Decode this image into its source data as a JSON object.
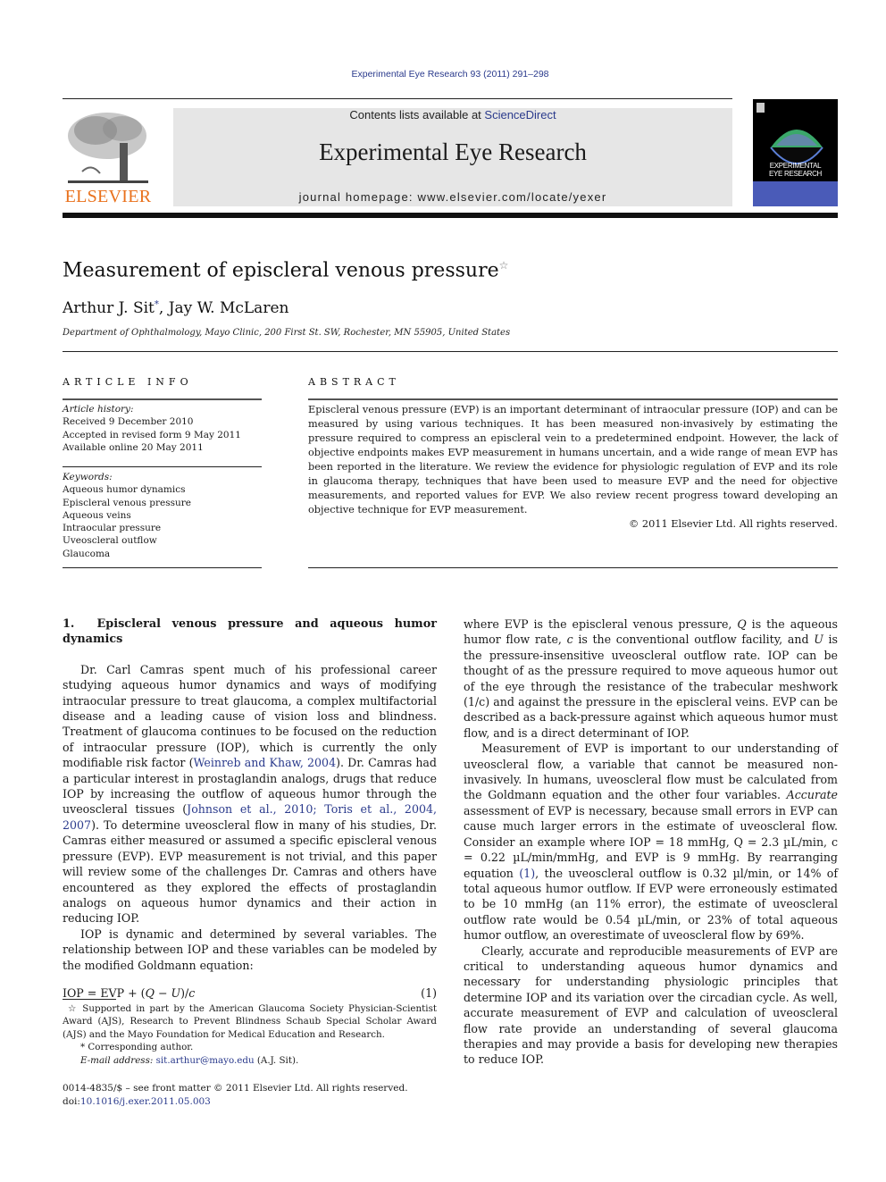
{
  "header": {
    "journal_ref": "Experimental Eye Research 93 (2011) 291–298",
    "contents_prefix": "Contents lists available at ",
    "contents_link": "ScienceDirect",
    "journal_title": "Experimental Eye Research",
    "homepage": "journal homepage: www.elsevier.com/locate/yexer",
    "publisher_logo_text": "ELSEVIER",
    "cover_title_line1": "EXPERIMENTAL",
    "cover_title_line2": "EYE RESEARCH",
    "colors": {
      "publisher_orange": "#e9711c",
      "link_blue": "#2a3a8c",
      "masthead_gray": "#e6e6e6",
      "cover_band": "#4a5bb8"
    }
  },
  "article": {
    "title": "Measurement of episcleral venous pressure",
    "title_note_mark": "☆",
    "author1": "Arthur J. Sit",
    "author1_mark": "*",
    "author2": ", Jay W. McLaren",
    "affiliation": "Department of Ophthalmology, Mayo Clinic, 200 First St. SW, Rochester, MN 55905, United States"
  },
  "article_info": {
    "heading": "ARTICLE INFO",
    "history_label": "Article history:",
    "history": [
      "Received 9 December 2010",
      "Accepted in revised form 9 May 2011",
      "Available online 20 May 2011"
    ],
    "keywords_label": "Keywords:",
    "keywords": [
      "Aqueous humor dynamics",
      "Episcleral venous pressure",
      "Aqueous veins",
      "Intraocular pressure",
      "Uveoscleral outflow",
      "Glaucoma"
    ]
  },
  "abstract": {
    "heading": "ABSTRACT",
    "text": "Episcleral venous pressure (EVP) is an important determinant of intraocular pressure (IOP) and can be measured by using various techniques. It has been measured non-invasively by estimating the pressure required to compress an episcleral vein to a predetermined endpoint. However, the lack of objective endpoints makes EVP measurement in humans uncertain, and a wide range of mean EVP has been reported in the literature. We review the evidence for physiologic regulation of EVP and its role in glaucoma therapy, techniques that have been used to measure EVP and the need for objective measurements, and reported values for EVP. We also review recent progress toward developing an objective technique for EVP measurement.",
    "copyright": "© 2011 Elsevier Ltd. All rights reserved."
  },
  "body": {
    "section1_title": "1.  Episcleral venous pressure and aqueous humor dynamics",
    "p1_a": "Dr. Carl Camras spent much of his professional career studying aqueous humor dynamics and ways of modifying intraocular pressure to treat glaucoma, a complex multifactorial disease and a leading cause of vision loss and blindness. Treatment of glaucoma continues to be focused on the reduction of intraocular pressure (IOP), which is currently the only modifiable risk factor (",
    "p1_ref1": "Weinreb and Khaw, 2004",
    "p1_b": "). Dr. Camras had a particular interest in prostaglandin analogs, drugs that reduce IOP by increasing the outflow of aqueous humor through the uveoscleral tissues (",
    "p1_ref2": "Johnson et al., 2010; Toris et al., 2004, 2007",
    "p1_c": "). To determine uveoscleral flow in many of his studies, Dr. Camras either measured or assumed a specific episcleral venous pressure (EVP). EVP measurement is not trivial, and this paper will review some of the challenges Dr. Camras and others have encountered as they explored the effects of prostaglandin analogs on aqueous humor dynamics and their action in reducing IOP.",
    "p2": "IOP is dynamic and determined by several variables. The relationship between IOP and these variables can be modeled by the modified Goldmann equation:",
    "equation_lhs": "IOP = EVP + (",
    "equation_q": "Q",
    "equation_minus": " − ",
    "equation_u": "U",
    "equation_div": ")/",
    "equation_c": "c",
    "equation_number": "(1)",
    "p3_a": "where EVP is the episcleral venous pressure, ",
    "p3_q": "Q",
    "p3_b": " is the aqueous humor flow rate, ",
    "p3_c": "c",
    "p3_d": " is the conventional outflow facility, and ",
    "p3_u": "U",
    "p3_e": " is the pressure-insensitive uveoscleral outflow rate. IOP can be thought of as the pressure required to move aqueous humor out of the eye through the resistance of the trabecular meshwork (1/c) and against the pressure in the episcleral veins. EVP can be described as a back-pressure against which aqueous humor must flow, and is a direct determinant of IOP.",
    "p4_a": "Measurement of EVP is important to our understanding of uveoscleral flow, a variable that cannot be measured non-invasively. In humans, uveoscleral flow must be calculated from the Goldmann equation and the other four variables. ",
    "p4_accurate": "Accurate",
    "p4_b": " assessment of EVP is necessary, because small errors in EVP can cause much larger errors in the estimate of uveoscleral flow. Consider an example where IOP = 18 mmHg, Q = 2.3 µL/min, c = 0.22 µL/min/mmHg, and EVP is 9 mmHg. By rearranging equation ",
    "p4_ref": "(1)",
    "p4_c": ", the uveoscleral outflow is 0.32 µl/min, or 14% of total aqueous humor outflow. If EVP were erroneously estimated to be 10 mmHg (an 11% error), the estimate of uveoscleral outflow rate would be 0.54 µL/min, or 23% of total aqueous humor outflow, an overestimate of uveoscleral flow by 69%.",
    "p5": "Clearly, accurate and reproducible measurements of EVP are critical to understanding aqueous humor dynamics and necessary for understanding physiologic principles that determine IOP and its variation over the circadian cycle. As well, accurate measurement of EVP and calculation of uveoscleral flow rate provide an understanding of several glaucoma therapies and may provide a basis for developing new therapies to reduce IOP."
  },
  "footnotes": {
    "star_mark": "☆",
    "funding": " Supported in part by the American Glaucoma Society Physician-Scientist Award (AJS), Research to Prevent Blindness Schaub Special Scholar Award (AJS) and the Mayo Foundation for Medical Education and Research.",
    "corr_mark": "*",
    "corresponding": " Corresponding author.",
    "email_label": "E-mail address: ",
    "email": "sit.arthur@mayo.edu",
    "email_suffix": " (A.J. Sit).",
    "issn_line": "0014-4835/$ – see front matter © 2011 Elsevier Ltd. All rights reserved.",
    "doi_label": "doi:",
    "doi": "10.1016/j.exer.2011.05.003"
  }
}
